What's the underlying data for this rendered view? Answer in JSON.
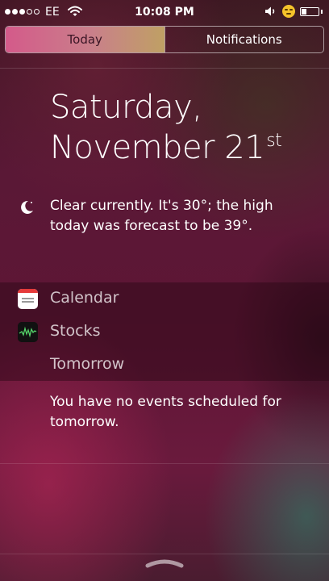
{
  "status_bar": {
    "carrier": "EE",
    "time": "10:08 PM",
    "signal_bars_filled": 3,
    "signal_bars_total": 5,
    "battery_level": 0.3
  },
  "tabs": [
    {
      "label": "Today",
      "active": true
    },
    {
      "label": "Notifications",
      "active": false
    }
  ],
  "date": {
    "weekday": "Saturday,",
    "month_day": "November 21",
    "suffix": "st"
  },
  "weather": {
    "icon": "moon-icon",
    "text": "Clear currently. It's 30°; the high today was forecast to be 39°."
  },
  "widgets": {
    "calendar_label": "Calendar",
    "stocks_label": "Stocks",
    "tomorrow_label": "Tomorrow",
    "no_events": "You have no events scheduled for tomorrow."
  },
  "colors": {
    "active_tab_start": "#d45a8a",
    "active_tab_end": "#bfa064",
    "calendar_red": "#e53a3a",
    "stocks_green": "#55d46a"
  }
}
